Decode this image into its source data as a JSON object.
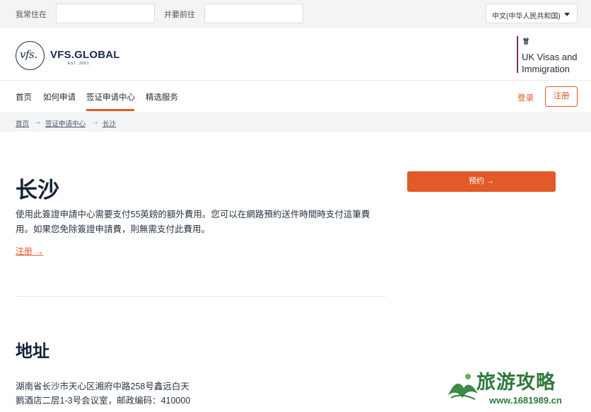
{
  "topbar": {
    "residence_label": "我常住在",
    "destination_label": "并要前往",
    "language": "中文(中华人民共和国)"
  },
  "header": {
    "vfs_logo_initials": "vfs.",
    "vfs_brand": "VFS.GLOBAL",
    "vfs_est": "EST. 2001",
    "uk_line1": "UK Visas and",
    "uk_line2": "Immigration"
  },
  "nav": {
    "items": [
      {
        "label": "首页"
      },
      {
        "label": "如何申请"
      },
      {
        "label": "签证申请中心"
      },
      {
        "label": "精选服务"
      }
    ],
    "active_index": 2,
    "login_label": "登录",
    "register_label": "注册"
  },
  "breadcrumb": {
    "items": [
      "首页",
      "签证申请中心",
      "长沙"
    ],
    "separator": "→"
  },
  "main": {
    "title": "长沙",
    "description": "使用此簽證申請中心需要支付55英鎊的額外費用。您可以在網路預約送件時間時支付這筆費用。如果您免除簽證申請費，則無需支付此費用。",
    "register_link": "注册 →",
    "book_button": "预约 →",
    "address_title": "地址",
    "address_line1": "湖南省长沙市天心区湘府中路258号鑫远白天",
    "address_line2": "鹅酒店二层1-3号会议室，邮政编码：410000"
  },
  "watermark": {
    "text": "旅游攻略",
    "url": "www.1681989.cn"
  },
  "colors": {
    "accent": "#e15a27",
    "navy": "#1a2b4c",
    "uk_purple": "#7a2a6b",
    "watermark_green": "#2e7a3d"
  }
}
